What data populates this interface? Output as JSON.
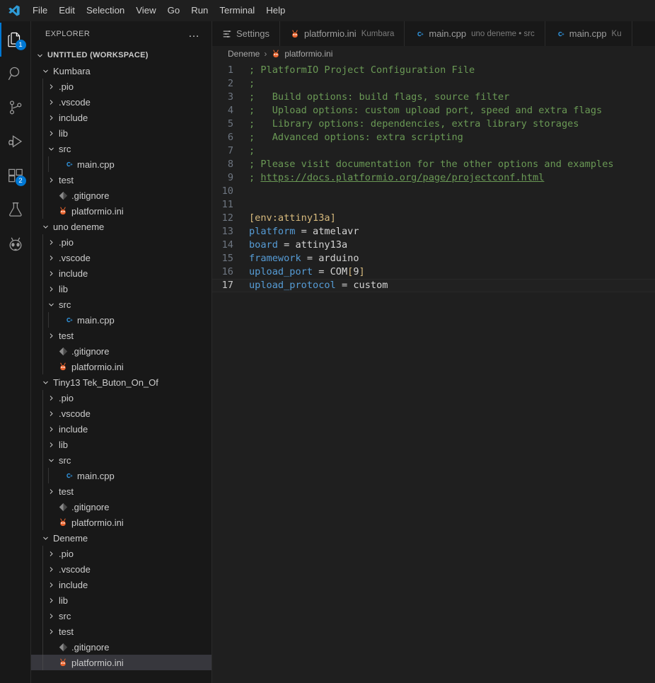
{
  "window": {
    "logo_icon": "vscode-logo-icon"
  },
  "menu": {
    "items": [
      {
        "label": "File"
      },
      {
        "label": "Edit"
      },
      {
        "label": "Selection"
      },
      {
        "label": "View"
      },
      {
        "label": "Go"
      },
      {
        "label": "Run"
      },
      {
        "label": "Terminal"
      },
      {
        "label": "Help"
      }
    ]
  },
  "activitybar": {
    "items": [
      {
        "name": "explorer",
        "icon": "files-icon",
        "badge": "1",
        "active": true
      },
      {
        "name": "search",
        "icon": "search-icon",
        "badge": "",
        "active": false
      },
      {
        "name": "source-control",
        "icon": "source-control-icon",
        "badge": "",
        "active": false
      },
      {
        "name": "run-debug",
        "icon": "run-and-debug-icon",
        "badge": "",
        "active": false
      },
      {
        "name": "extensions",
        "icon": "extensions-icon",
        "badge": "2",
        "active": false
      },
      {
        "name": "testing",
        "icon": "beaker-icon",
        "badge": "",
        "active": false
      },
      {
        "name": "platformio",
        "icon": "platformio-ant-icon",
        "badge": "",
        "active": false
      }
    ]
  },
  "sidebar": {
    "title": "EXPLORER",
    "more_actions_label": "…",
    "tree": [
      {
        "label": "UNTITLED (WORKSPACE)",
        "depth": 0,
        "twisty": "down",
        "icon": "none",
        "root": true,
        "selected": false
      },
      {
        "label": "Kumbara",
        "depth": 1,
        "twisty": "down",
        "icon": "none",
        "root": false,
        "selected": false
      },
      {
        "label": ".pio",
        "depth": 2,
        "twisty": "right",
        "icon": "none",
        "root": false,
        "selected": false
      },
      {
        "label": ".vscode",
        "depth": 2,
        "twisty": "right",
        "icon": "none",
        "root": false,
        "selected": false
      },
      {
        "label": "include",
        "depth": 2,
        "twisty": "right",
        "icon": "none",
        "root": false,
        "selected": false
      },
      {
        "label": "lib",
        "depth": 2,
        "twisty": "right",
        "icon": "none",
        "root": false,
        "selected": false
      },
      {
        "label": "src",
        "depth": 2,
        "twisty": "down",
        "icon": "none",
        "root": false,
        "selected": false
      },
      {
        "label": "main.cpp",
        "depth": 3,
        "twisty": "none",
        "icon": "cpp-icon",
        "root": false,
        "selected": false
      },
      {
        "label": "test",
        "depth": 2,
        "twisty": "right",
        "icon": "none",
        "root": false,
        "selected": false
      },
      {
        "label": ".gitignore",
        "depth": 2,
        "twisty": "none",
        "icon": "git-icon",
        "root": false,
        "selected": false
      },
      {
        "label": "platformio.ini",
        "depth": 2,
        "twisty": "none",
        "icon": "platformio-icon",
        "root": false,
        "selected": false
      },
      {
        "label": "uno deneme",
        "depth": 1,
        "twisty": "down",
        "icon": "none",
        "root": false,
        "selected": false
      },
      {
        "label": ".pio",
        "depth": 2,
        "twisty": "right",
        "icon": "none",
        "root": false,
        "selected": false
      },
      {
        "label": ".vscode",
        "depth": 2,
        "twisty": "right",
        "icon": "none",
        "root": false,
        "selected": false
      },
      {
        "label": "include",
        "depth": 2,
        "twisty": "right",
        "icon": "none",
        "root": false,
        "selected": false
      },
      {
        "label": "lib",
        "depth": 2,
        "twisty": "right",
        "icon": "none",
        "root": false,
        "selected": false
      },
      {
        "label": "src",
        "depth": 2,
        "twisty": "down",
        "icon": "none",
        "root": false,
        "selected": false
      },
      {
        "label": "main.cpp",
        "depth": 3,
        "twisty": "none",
        "icon": "cpp-icon",
        "root": false,
        "selected": false
      },
      {
        "label": "test",
        "depth": 2,
        "twisty": "right",
        "icon": "none",
        "root": false,
        "selected": false
      },
      {
        "label": ".gitignore",
        "depth": 2,
        "twisty": "none",
        "icon": "git-icon",
        "root": false,
        "selected": false
      },
      {
        "label": "platformio.ini",
        "depth": 2,
        "twisty": "none",
        "icon": "platformio-icon",
        "root": false,
        "selected": false
      },
      {
        "label": "Tiny13 Tek_Buton_On_Of",
        "depth": 1,
        "twisty": "down",
        "icon": "none",
        "root": false,
        "selected": false
      },
      {
        "label": ".pio",
        "depth": 2,
        "twisty": "right",
        "icon": "none",
        "root": false,
        "selected": false
      },
      {
        "label": ".vscode",
        "depth": 2,
        "twisty": "right",
        "icon": "none",
        "root": false,
        "selected": false
      },
      {
        "label": "include",
        "depth": 2,
        "twisty": "right",
        "icon": "none",
        "root": false,
        "selected": false
      },
      {
        "label": "lib",
        "depth": 2,
        "twisty": "right",
        "icon": "none",
        "root": false,
        "selected": false
      },
      {
        "label": "src",
        "depth": 2,
        "twisty": "down",
        "icon": "none",
        "root": false,
        "selected": false
      },
      {
        "label": "main.cpp",
        "depth": 3,
        "twisty": "none",
        "icon": "cpp-icon",
        "root": false,
        "selected": false
      },
      {
        "label": "test",
        "depth": 2,
        "twisty": "right",
        "icon": "none",
        "root": false,
        "selected": false
      },
      {
        "label": ".gitignore",
        "depth": 2,
        "twisty": "none",
        "icon": "git-icon",
        "root": false,
        "selected": false
      },
      {
        "label": "platformio.ini",
        "depth": 2,
        "twisty": "none",
        "icon": "platformio-icon",
        "root": false,
        "selected": false
      },
      {
        "label": "Deneme",
        "depth": 1,
        "twisty": "down",
        "icon": "none",
        "root": false,
        "selected": false
      },
      {
        "label": ".pio",
        "depth": 2,
        "twisty": "right",
        "icon": "none",
        "root": false,
        "selected": false
      },
      {
        "label": ".vscode",
        "depth": 2,
        "twisty": "right",
        "icon": "none",
        "root": false,
        "selected": false
      },
      {
        "label": "include",
        "depth": 2,
        "twisty": "right",
        "icon": "none",
        "root": false,
        "selected": false
      },
      {
        "label": "lib",
        "depth": 2,
        "twisty": "right",
        "icon": "none",
        "root": false,
        "selected": false
      },
      {
        "label": "src",
        "depth": 2,
        "twisty": "right",
        "icon": "none",
        "root": false,
        "selected": false
      },
      {
        "label": "test",
        "depth": 2,
        "twisty": "right",
        "icon": "none",
        "root": false,
        "selected": false
      },
      {
        "label": ".gitignore",
        "depth": 2,
        "twisty": "none",
        "icon": "git-icon",
        "root": false,
        "selected": false
      },
      {
        "label": "platformio.ini",
        "depth": 2,
        "twisty": "none",
        "icon": "platformio-icon",
        "root": false,
        "selected": true
      }
    ]
  },
  "tabs": [
    {
      "label": "Settings",
      "description": "",
      "icon": "settings-lines-icon",
      "active": false
    },
    {
      "label": "platformio.ini",
      "description": "Kumbara",
      "icon": "platformio-icon",
      "active": false
    },
    {
      "label": "main.cpp",
      "description": "uno deneme • src",
      "icon": "cpp-icon",
      "active": false
    },
    {
      "label": "main.cpp",
      "description": "Ku",
      "icon": "cpp-icon",
      "active": false
    }
  ],
  "breadcrumb": {
    "items": [
      {
        "label": "Deneme",
        "icon": "none"
      },
      {
        "label": "platformio.ini",
        "icon": "platformio-icon"
      }
    ],
    "separator": "›"
  },
  "editor": {
    "active_line": 17,
    "lines": [
      {
        "n": "1",
        "segments": [
          {
            "t": "; PlatformIO Project Configuration File",
            "c": "c-comment"
          }
        ]
      },
      {
        "n": "2",
        "segments": [
          {
            "t": ";",
            "c": "c-comment"
          }
        ]
      },
      {
        "n": "3",
        "segments": [
          {
            "t": ";   Build options: build flags, source filter",
            "c": "c-comment"
          }
        ]
      },
      {
        "n": "4",
        "segments": [
          {
            "t": ";   Upload options: custom upload port, speed and extra flags",
            "c": "c-comment"
          }
        ]
      },
      {
        "n": "5",
        "segments": [
          {
            "t": ";   Library options: dependencies, extra library storages",
            "c": "c-comment"
          }
        ]
      },
      {
        "n": "6",
        "segments": [
          {
            "t": ";   Advanced options: extra scripting",
            "c": "c-comment"
          }
        ]
      },
      {
        "n": "7",
        "segments": [
          {
            "t": ";",
            "c": "c-comment"
          }
        ]
      },
      {
        "n": "8",
        "segments": [
          {
            "t": "; Please visit documentation for the other options and examples",
            "c": "c-comment"
          }
        ]
      },
      {
        "n": "9",
        "segments": [
          {
            "t": "; ",
            "c": "c-comment"
          },
          {
            "t": "https://docs.platformio.org/page/projectconf.html",
            "c": "c-link"
          }
        ]
      },
      {
        "n": "10",
        "segments": [
          {
            "t": "",
            "c": "c-comment"
          }
        ]
      },
      {
        "n": "11",
        "segments": [
          {
            "t": "",
            "c": "c-comment"
          }
        ]
      },
      {
        "n": "12",
        "segments": [
          {
            "t": "[env:attiny13a]",
            "c": "c-section"
          }
        ]
      },
      {
        "n": "13",
        "segments": [
          {
            "t": "platform",
            "c": "c-key"
          },
          {
            "t": " = ",
            "c": "c-op"
          },
          {
            "t": "atmelavr",
            "c": "c-val"
          }
        ]
      },
      {
        "n": "14",
        "segments": [
          {
            "t": "board",
            "c": "c-key"
          },
          {
            "t": " = ",
            "c": "c-op"
          },
          {
            "t": "attiny13a",
            "c": "c-val"
          }
        ]
      },
      {
        "n": "15",
        "segments": [
          {
            "t": "framework",
            "c": "c-key"
          },
          {
            "t": " = ",
            "c": "c-op"
          },
          {
            "t": "arduino",
            "c": "c-val"
          }
        ]
      },
      {
        "n": "16",
        "segments": [
          {
            "t": "upload_port",
            "c": "c-key"
          },
          {
            "t": " = ",
            "c": "c-op"
          },
          {
            "t": "COM",
            "c": "c-val"
          },
          {
            "t": "[",
            "c": "c-bracket"
          },
          {
            "t": "9",
            "c": "c-val"
          },
          {
            "t": "]",
            "c": "c-bracket"
          }
        ]
      },
      {
        "n": "17",
        "segments": [
          {
            "t": "upload_protocol",
            "c": "c-key"
          },
          {
            "t": " = ",
            "c": "c-op"
          },
          {
            "t": "custom",
            "c": "c-val"
          }
        ]
      }
    ]
  },
  "colors": {
    "accent": "#0078d4",
    "editor_bg": "#1f1f1f",
    "sidebar_bg": "#181818",
    "comment": "#6a9955",
    "key": "#569cd6",
    "section": "#d7ba7d",
    "platformio_orange": "#e8622c"
  }
}
